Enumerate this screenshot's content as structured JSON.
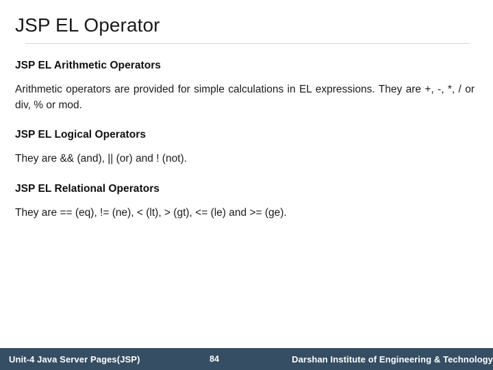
{
  "slide": {
    "title": "JSP EL Operator",
    "sections": [
      {
        "heading": "JSP EL Arithmetic Operators",
        "body": "Arithmetic operators are provided for simple calculations in EL expressions. They are +, -, *, / or div, % or mod."
      },
      {
        "heading": "JSP EL Logical Operators",
        "body": "They are && (and), || (or) and ! (not)."
      },
      {
        "heading": "JSP EL Relational Operators",
        "body": "They are == (eq), != (ne), < (lt), > (gt), <= (le) and >= (ge)."
      }
    ]
  },
  "footer": {
    "left": "Unit-4 Java Server Pages(JSP)",
    "page_number": "84",
    "right": "Darshan Institute of Engineering & Technology",
    "background_color": "#364e63",
    "text_color": "#ffffff"
  }
}
